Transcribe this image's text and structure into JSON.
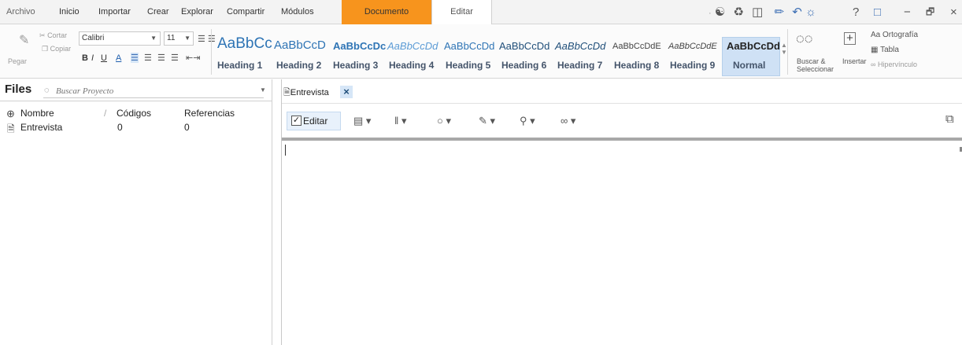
{
  "menu": {
    "items": [
      "Archivo",
      "Inicio",
      "Importar",
      "Crear",
      "Explorar",
      "Compartir",
      "Módulos"
    ],
    "document_tab": "Documento",
    "edit_tab": "Editar",
    "help_glyph": "?",
    "minimize_glyph": "−",
    "restore_glyph": "🗗",
    "close_glyph": "×"
  },
  "ribbon": {
    "cut": "Cortar",
    "copy": "Copiar",
    "paste": "Pegar",
    "font_name": "Calibri",
    "font_size": "11",
    "bold": "B",
    "italic": "I",
    "underline": "U",
    "font_color": "A",
    "style_sample": [
      "AaBbCc",
      "AaBbCcD",
      "AaBbCcDc",
      "AaBbCcDd",
      "AaBbCcDd",
      "AaBbCcDd",
      "AaBbCcDd",
      "AaBbCcDdE",
      "AaBbCcDdE",
      "AaBbCcDd"
    ],
    "style_names": [
      "Heading 1",
      "Heading 2",
      "Heading 3",
      "Heading 4",
      "Heading 5",
      "Heading 6",
      "Heading 7",
      "Heading 8",
      "Heading 9",
      "Normal"
    ],
    "find_line1": "Buscar &",
    "find_line2": "Seleccionar",
    "insert": "Insertar",
    "spelling": "Ortografía",
    "spelling_prefix": "Aa",
    "table": "Tabla",
    "hyperlink": "Hipervínculo"
  },
  "files": {
    "title": "Files",
    "search_placeholder": "Buscar Proyecto",
    "columns": [
      "Nombre",
      "Códigos",
      "Referencias"
    ],
    "rows": [
      {
        "name": "Entrevista",
        "codes": "0",
        "refs": "0"
      }
    ]
  },
  "document": {
    "tab_label": "Entrevista",
    "tab_close": "×",
    "edit_label": "Editar",
    "edit_checked": "✓"
  },
  "colors": {
    "document_tab": "#f7941d",
    "normal_style_highlight": "#cfe1f5",
    "heading_text": "#2e74b5",
    "tab_close_bg": "#d6e6f7"
  },
  "icons": [
    "user-circle-icon",
    "sync-icon",
    "save-icon",
    "pen-icon",
    "undo-icon",
    "globe-icon",
    "help-icon",
    "comment-icon",
    "binoculars-icon",
    "insert-icon",
    "table-icon",
    "link-icon",
    "file-icon",
    "add-circle-icon"
  ]
}
